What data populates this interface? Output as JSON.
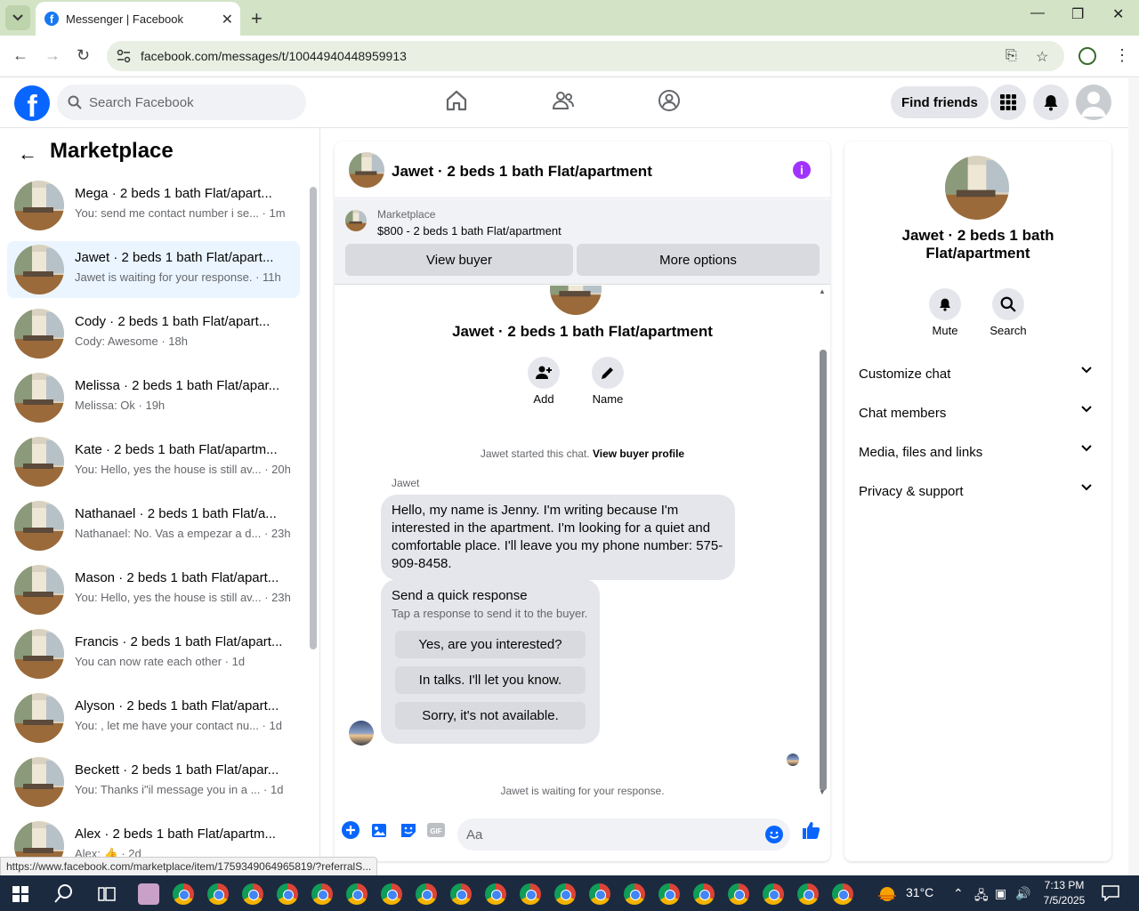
{
  "browser": {
    "tab_title": "Messenger | Facebook",
    "url": "facebook.com/messages/t/10044940448959913",
    "status_url": "https://www.facebook.com/marketplace/item/1759349064965819/?referralS..."
  },
  "header": {
    "search_placeholder": "Search Facebook",
    "find_friends": "Find friends"
  },
  "left": {
    "title": "Marketplace",
    "conversations": [
      {
        "name": "Mega · 2 beds 1 bath Flat/apart...",
        "preview": "You: send me contact number i se...",
        "time": "· 1m"
      },
      {
        "name": "Jawet · 2 beds 1 bath Flat/apart...",
        "preview": "Jawet is waiting for your response.",
        "time": "· 11h"
      },
      {
        "name": "Cody · 2 beds 1 bath Flat/apart...",
        "preview": "Cody: Awesome",
        "time": "· 18h"
      },
      {
        "name": "Melissa · 2 beds 1 bath Flat/apar...",
        "preview": "Melissa: Ok",
        "time": "· 19h"
      },
      {
        "name": "Kate · 2 beds 1 bath Flat/apartm...",
        "preview": "You: Hello, yes the house is still av...",
        "time": "· 20h"
      },
      {
        "name": "Nathanael · 2 beds 1 bath Flat/a...",
        "preview": "Nathanael: No. Vas a empezar a d...",
        "time": "· 23h"
      },
      {
        "name": "Mason · 2 beds 1 bath Flat/apart...",
        "preview": "You: Hello, yes the house is still av...",
        "time": "· 23h"
      },
      {
        "name": "Francis · 2 beds 1 bath Flat/apart...",
        "preview": "You can now rate each other",
        "time": "· 1d"
      },
      {
        "name": "Alyson · 2 beds 1 bath Flat/apart...",
        "preview": "You: , let me have your contact nu...",
        "time": "· 1d"
      },
      {
        "name": "Beckett · 2 beds 1 bath Flat/apar...",
        "preview": "You: Thanks i\"il message you in a ...",
        "time": "· 1d"
      },
      {
        "name": "Alex · 2 beds 1 bath Flat/apartm...",
        "preview": "Alex: 👍",
        "time": "· 2d"
      }
    ]
  },
  "chat": {
    "title": "Jawet · 2 beds 1 bath Flat/apartment",
    "marketplace_label": "Marketplace",
    "listing": "$800 - 2 beds 1 bath Flat/apartment",
    "view_buyer": "View buyer",
    "more_options": "More options",
    "profile_name": "Jawet · 2 beds 1 bath Flat/apartment",
    "add_label": "Add",
    "name_label": "Name",
    "started_text": "Jawet started this chat.",
    "view_buyer_profile": "View buyer profile",
    "sender": "Jawet",
    "message": "Hello, my name is Jenny. I'm writing because I'm interested in the apartment. I'm looking for a quiet and comfortable place. I'll leave you my phone number: 575-909-8458.",
    "quick_title": "Send a quick response",
    "quick_sub": "Tap a response to send it to the buyer.",
    "quick_replies": [
      "Yes, are you interested?",
      "In talks. I'll let you know.",
      "Sorry, it's not available."
    ],
    "waiting": "Jawet is waiting for your response.",
    "composer_placeholder": "Aa"
  },
  "right": {
    "name": "Jawet · 2 beds 1 bath Flat/apartment",
    "mute": "Mute",
    "search": "Search",
    "sections": [
      "Customize chat",
      "Chat members",
      "Media, files and links",
      "Privacy & support"
    ]
  },
  "taskbar": {
    "temp": "31°C",
    "time": "7:13 PM",
    "date": "7/5/2025"
  },
  "colors": {
    "accent": "#0866ff",
    "info": "#a033ff",
    "active_row": "#ebf5ff"
  }
}
